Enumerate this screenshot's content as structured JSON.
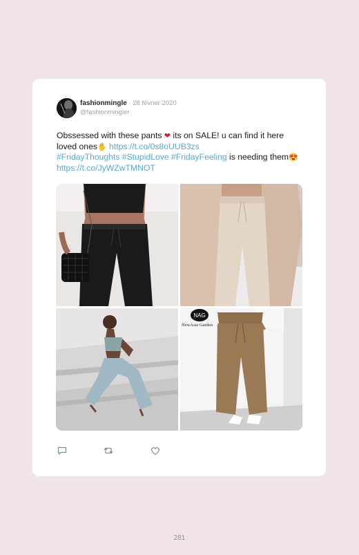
{
  "tweet": {
    "author": "fashionmingle",
    "date_separator": " · ",
    "date": "28 février 2020",
    "handle": "@fashionmingler",
    "text_part1": "Obssessed with these pants ",
    "text_part2": " its on SALE! u can find it here loved ones",
    "link1": "https://t.co/0s8oUUB3zs",
    "hashtag1": "#FridayThoughts",
    "hashtag2": "#StupidLove",
    "hashtag3": "#FridayFeeling",
    "text_part3": " is needing them",
    "link2": "https://t.co/JyWZwTMNOT",
    "emoji_heart": "❤",
    "emoji_hand": "✋",
    "emoji_hearteyes": "😍"
  },
  "photos": [
    {
      "alt": "black-joggers-photo"
    },
    {
      "alt": "beige-joggers-photo"
    },
    {
      "alt": "blue-joggers-photo"
    },
    {
      "alt": "khaki-joggers-photo",
      "logo_text": "NewAsia Garden"
    }
  ],
  "icons": [
    "reply-icon",
    "retweet-icon",
    "like-icon"
  ],
  "page_number": "281",
  "colors": {
    "background": "#f1e4e6",
    "card": "#ffffff",
    "link": "#55a9d6",
    "muted": "#9aa3aa"
  }
}
